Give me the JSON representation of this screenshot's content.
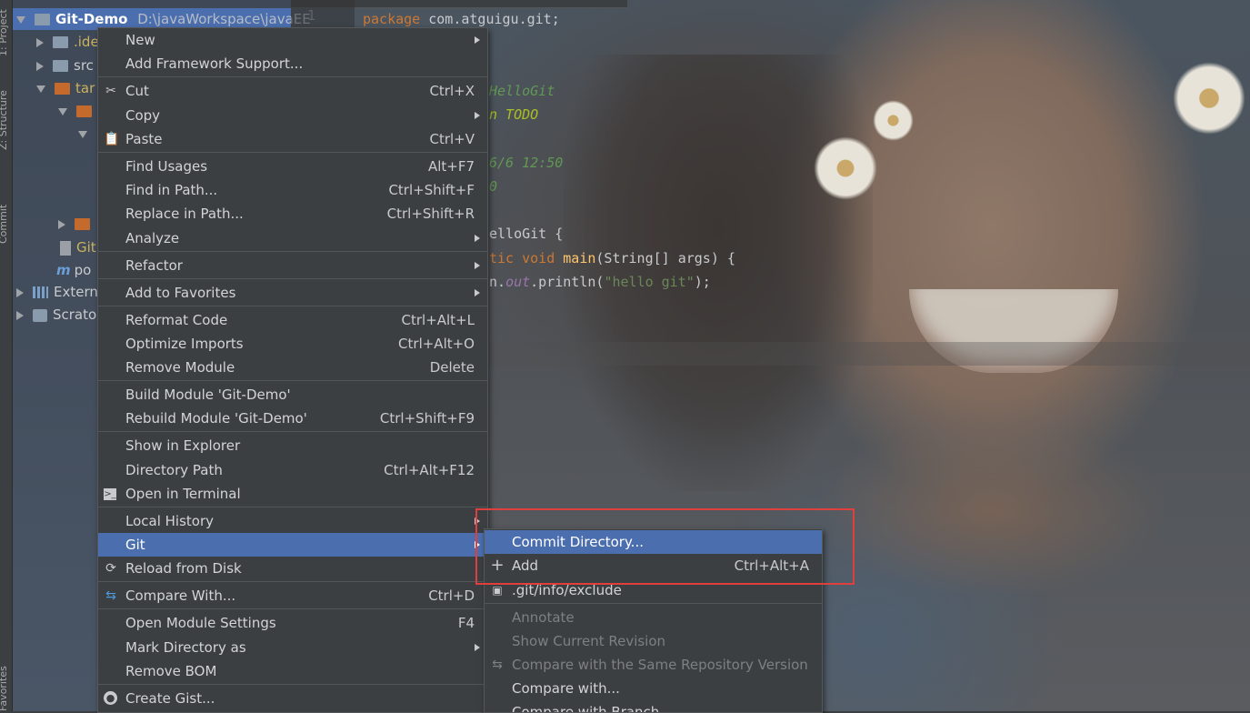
{
  "tool_window": {
    "stripe_labels": [
      "1: Project",
      "Z: Structure",
      "Commit",
      "Favorites"
    ]
  },
  "project_tree": {
    "root_label": "Git-Demo",
    "root_path": "D:\\javaWorkspace\\javaEE",
    "items": [
      {
        "label": ".idea",
        "visible": ".ide"
      },
      {
        "label": "src",
        "visible": "src"
      },
      {
        "label": "target",
        "visible": "tar"
      },
      {
        "label": "Git",
        "visible": "Git"
      },
      {
        "label": "pom",
        "visible": "po"
      },
      {
        "label": "External",
        "visible": "Extern"
      },
      {
        "label": "Scratches",
        "visible": "Scrato"
      }
    ]
  },
  "editor": {
    "line_number": "1",
    "code": {
      "line1_kw": "package",
      "line1_rest": " com.atguigu.git;",
      "line2": "HelloGit",
      "line3_a": "n",
      "line3_b": " TODO",
      "line4": "6/6 12:50",
      "line5": "0",
      "line6": "elloGit {",
      "line7_kw": "tic void ",
      "line7_fn": "main",
      "line7_rest": "(String[] args) {",
      "line8_a": "n.",
      "line8_out": "out",
      "line8_b": ".println(",
      "line8_str": "\"hello git\"",
      "line8_c": ");"
    }
  },
  "context_menu": {
    "items": [
      {
        "label": "New",
        "shortcut": "",
        "submenu": true
      },
      {
        "label": "Add Framework Support...",
        "shortcut": ""
      },
      {
        "label": "Cut",
        "shortcut": "Ctrl+X",
        "icon": "scissors-icon"
      },
      {
        "label": "Copy",
        "shortcut": "",
        "submenu": true
      },
      {
        "label": "Paste",
        "shortcut": "Ctrl+V",
        "icon": "clipboard-icon"
      },
      {
        "label": "Find Usages",
        "shortcut": "Alt+F7"
      },
      {
        "label": "Find in Path...",
        "shortcut": "Ctrl+Shift+F"
      },
      {
        "label": "Replace in Path...",
        "shortcut": "Ctrl+Shift+R"
      },
      {
        "label": "Analyze",
        "shortcut": "",
        "submenu": true
      },
      {
        "label": "Refactor",
        "shortcut": "",
        "submenu": true
      },
      {
        "label": "Add to Favorites",
        "shortcut": "",
        "submenu": true
      },
      {
        "label": "Reformat Code",
        "shortcut": "Ctrl+Alt+L"
      },
      {
        "label": "Optimize Imports",
        "shortcut": "Ctrl+Alt+O"
      },
      {
        "label": "Remove Module",
        "shortcut": "Delete"
      },
      {
        "label": "Build Module 'Git-Demo'",
        "shortcut": ""
      },
      {
        "label": "Rebuild Module 'Git-Demo'",
        "shortcut": "Ctrl+Shift+F9"
      },
      {
        "label": "Show in Explorer",
        "shortcut": ""
      },
      {
        "label": "Directory Path",
        "shortcut": "Ctrl+Alt+F12"
      },
      {
        "label": "Open in Terminal",
        "shortcut": "",
        "icon": "terminal-icon"
      },
      {
        "label": "Local History",
        "shortcut": "",
        "submenu": true
      },
      {
        "label": "Git",
        "shortcut": "",
        "submenu": true,
        "selected": true
      },
      {
        "label": "Reload from Disk",
        "shortcut": "",
        "icon": "reload-icon"
      },
      {
        "label": "Compare With...",
        "shortcut": "Ctrl+D",
        "icon": "compare-icon"
      },
      {
        "label": "Open Module Settings",
        "shortcut": "F4"
      },
      {
        "label": "Mark Directory as",
        "shortcut": "",
        "submenu": true
      },
      {
        "label": "Remove BOM",
        "shortcut": ""
      },
      {
        "label": "Create Gist...",
        "shortcut": "",
        "icon": "github-icon"
      }
    ]
  },
  "git_submenu": {
    "items": [
      {
        "label": "Commit Directory...",
        "shortcut": "",
        "selected": true
      },
      {
        "label": "Add",
        "shortcut": "Ctrl+Alt+A",
        "icon": "plus-icon"
      },
      {
        "label": ".git/info/exclude",
        "shortcut": "",
        "icon": "git-file-icon"
      },
      {
        "label": "Annotate",
        "shortcut": "",
        "disabled": true
      },
      {
        "label": "Show Current Revision",
        "shortcut": "",
        "disabled": true
      },
      {
        "label": "Compare with the Same Repository Version",
        "shortcut": "",
        "disabled": true,
        "icon": "compare-icon"
      },
      {
        "label": "Compare with...",
        "shortcut": ""
      },
      {
        "label": "Compare with Branch...",
        "shortcut": ""
      }
    ]
  },
  "colors": {
    "selection": "#4b6eaf",
    "menu_bg": "#3c3f41",
    "highlight_box": "#e0403d"
  }
}
